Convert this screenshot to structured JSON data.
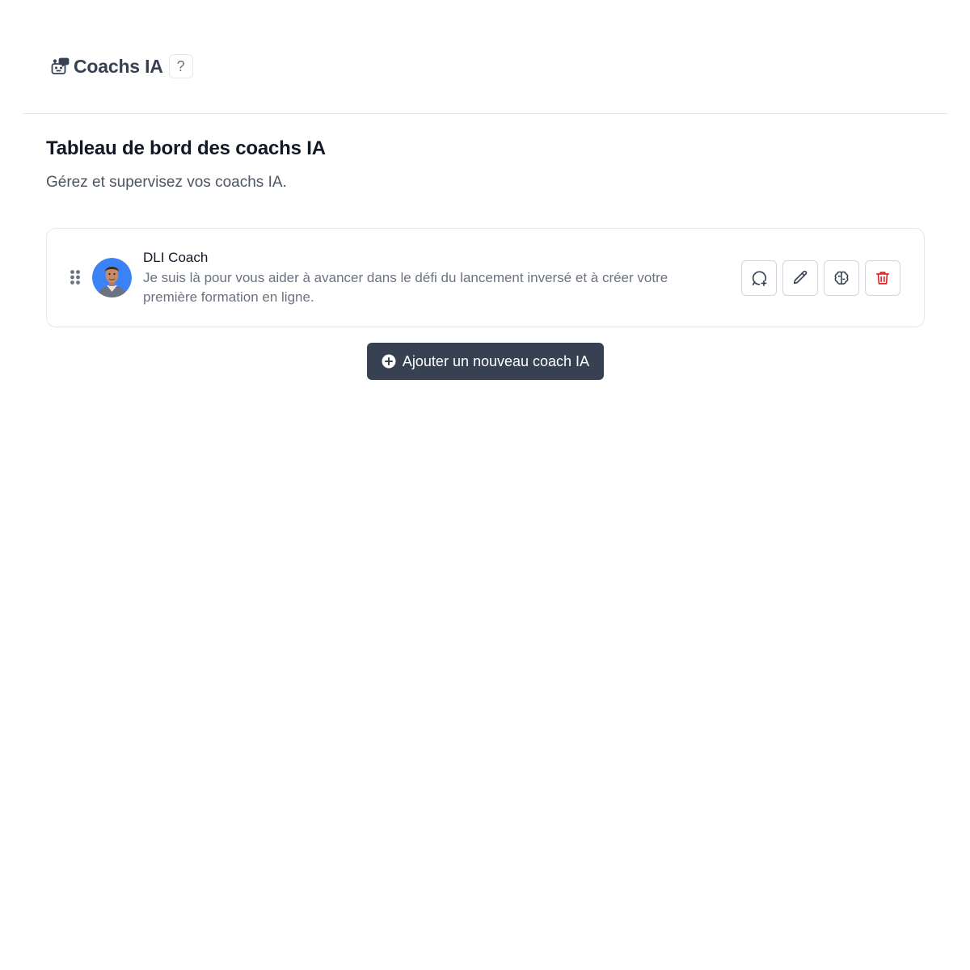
{
  "header": {
    "title": "Coachs IA",
    "help_label": "?",
    "brand_icon": "robot-chat-icon"
  },
  "main": {
    "title": "Tableau de bord des coachs IA",
    "subtitle": "Gérez et supervisez vos coachs IA."
  },
  "coaches": [
    {
      "name": "DLI Coach",
      "description": "Je suis là pour vous aider à avancer dans le défi du lancement inversé et à créer votre première formation en ligne.",
      "avatar": "avatar-cartoon-man",
      "actions": [
        "chat-plus-icon",
        "pencil-icon",
        "brain-icon",
        "trash-icon"
      ]
    }
  ],
  "add_button": {
    "label": "Ajouter un nouveau coach IA",
    "icon": "plus-circle-icon"
  },
  "colors": {
    "primary_button": "#374151",
    "danger": "#dc2626",
    "border": "#e5e7eb",
    "text_muted": "#6b7280"
  }
}
